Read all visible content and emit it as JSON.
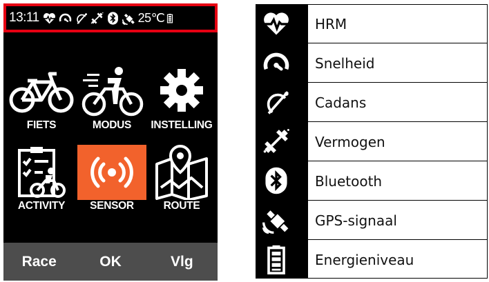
{
  "status_bar": {
    "time": "13:11",
    "temperature": "25℃",
    "icons": [
      "heart-rate-icon",
      "speed-icon",
      "cadence-icon",
      "power-icon",
      "bluetooth-icon",
      "gps-satellite-icon",
      "battery-icon"
    ],
    "highlight_color": "#e60012"
  },
  "menu": {
    "tiles": [
      {
        "label": "FIETS",
        "icon": "bicycle-icon",
        "selected": false
      },
      {
        "label": "MODUS",
        "icon": "cyclist-mode-icon",
        "selected": false
      },
      {
        "label": "INSTELLING",
        "icon": "gear-icon",
        "selected": false
      },
      {
        "label": "ACTIVITY",
        "icon": "activity-clipboard-icon",
        "selected": false
      },
      {
        "label": "SENSOR",
        "icon": "sensor-broadcast-icon",
        "selected": true
      },
      {
        "label": "ROUTE",
        "icon": "route-map-icon",
        "selected": false
      }
    ],
    "selected_color": "#f2622c"
  },
  "softkeys": {
    "left": "Race",
    "center": "OK",
    "right": "Vlg"
  },
  "legend": [
    {
      "icon": "heart-rate-icon",
      "label": "HRM"
    },
    {
      "icon": "speed-icon",
      "label": "Snelheid"
    },
    {
      "icon": "cadence-icon",
      "label": "Cadans"
    },
    {
      "icon": "power-icon",
      "label": "Vermogen"
    },
    {
      "icon": "bluetooth-icon",
      "label": "Bluetooth"
    },
    {
      "icon": "gps-satellite-icon",
      "label": "GPS-signaal"
    },
    {
      "icon": "battery-icon",
      "label": "Energieniveau"
    }
  ]
}
